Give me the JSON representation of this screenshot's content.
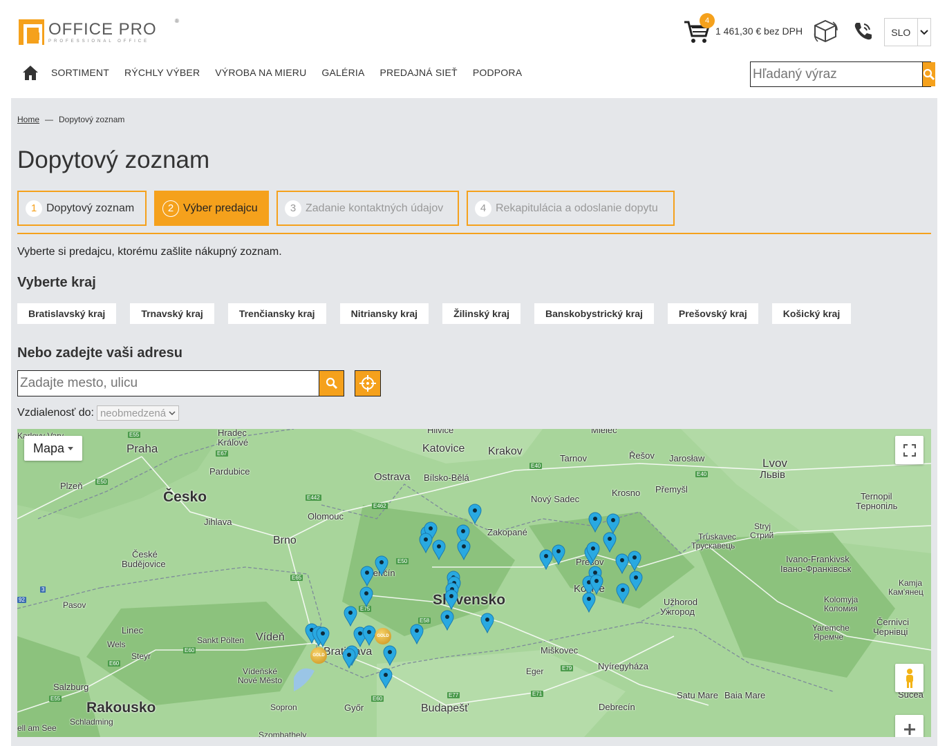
{
  "brand": {
    "name": "OFFICE PRO",
    "tagline": "PROFESSIONAL OFFICE",
    "reg": "®"
  },
  "cart": {
    "count": "4",
    "total": "1 461,30 € bez DPH"
  },
  "language": {
    "selected": "SLO"
  },
  "nav": {
    "items": [
      "SORTIMENT",
      "RÝCHLY VÝBER",
      "VÝROBA NA MIERU",
      "GALÉRIA",
      "PREDAJNÁ SIEŤ",
      "PODPORA"
    ]
  },
  "search": {
    "placeholder": "Hľadaný výraz"
  },
  "breadcrumb": {
    "home": "Home",
    "sep": "—",
    "current": "Dopytový zoznam"
  },
  "page": {
    "title": "Dopytový zoznam",
    "intro": "Vyberte si predajcu, ktorému zašlite nákupný zoznam."
  },
  "steps": [
    {
      "num": "1",
      "label": "Dopytový zoznam"
    },
    {
      "num": "2",
      "label": "Výber predajcu"
    },
    {
      "num": "3",
      "label": "Zadanie kontaktných údajov"
    },
    {
      "num": "4",
      "label": "Rekapitulácia a odoslanie dopytu"
    }
  ],
  "regions": {
    "heading": "Vyberte kraj",
    "items": [
      "Bratislavský kraj",
      "Trnavský kraj",
      "Trenčiansky kraj",
      "Nitriansky kraj",
      "Žilinský kraj",
      "Banskobystrický kraj",
      "Prešovský kraj",
      "Košický kraj"
    ]
  },
  "address": {
    "heading": "Nebo zadejte vaši adresu",
    "placeholder": "Zadajte mesto, ulicu",
    "distance_label": "Vzdialenosť do:",
    "distance_value": "neobmedzená"
  },
  "map": {
    "type_label": "Mapa",
    "places": {
      "karlovy": "Karlovy Vary",
      "hradec": "Hradec",
      "kralove": "Králové",
      "praha": "Praha",
      "pardubice": "Pardubice",
      "plzen": "Plzeň",
      "cesko": "Česko",
      "jihlava": "Jihlava",
      "olomouc": "Olomouc",
      "ostrava": "Ostrava",
      "bielsko": "Bílsko-Bělá",
      "katovice": "Katovice",
      "krakov": "Krakov",
      "tarnov": "Tarnov",
      "resov": "Řešov",
      "jaroslaw": "Jarosław",
      "lvov": "Lvov",
      "lvov2": "Львів",
      "mielec": "Mielec",
      "hlivice": "Hlivice",
      "novysadec": "Nový Sadec",
      "krosno": "Krosno",
      "przemysl": "Přemyšl",
      "zakopane": "Zakopané",
      "brno": "Brno",
      "ceske": "České",
      "budejovice": "Budějovice",
      "trencin": "Trenčín",
      "slovensko": "Slovensko",
      "presov": "Prešov",
      "kosice": "Košice",
      "truskavec": "Truskavec",
      "truskavec2": "Трускавець",
      "stryj": "Stryj",
      "stryj2": "Стрий",
      "ternopil": "Ternopil",
      "ternopil2": "Тернопіль",
      "ivano": "Ivano-Frankivsk",
      "ivano2": "Івано-Франківськ",
      "kamja": "Kamja",
      "kamja2": "Кам'янец",
      "uzhorod": "Užhorod",
      "uzhorod2": "Ужгород",
      "kolomyja": "Kolomyja",
      "kolomyja2": "Коломия",
      "yaremche": "Yaremche",
      "yaremche2": "Яремче",
      "cernivci": "Černivci",
      "cernivci2": "Чернівці",
      "pasov": "Pasov",
      "linec": "Linec",
      "wels": "Wels",
      "steyr": "Steyr",
      "sanktpolten": "Sankt Pölten",
      "viden": "Vídeň",
      "bratislava": "Bratislava",
      "videnske": "Vídeňské",
      "novemesto": "Nové Město",
      "salzburg": "Salzburg",
      "rakousko": "Rakousko",
      "schladming": "Schladming",
      "sopron": "Sopron",
      "gyor": "Győr",
      "budapest": "Budapešť",
      "miskovec": "Miškovec",
      "eger": "Eger",
      "nyiregyhaza": "Nyíregyháza",
      "debrecin": "Debrecín",
      "satumare": "Satu Mare",
      "baiamare": "Baia Mare",
      "suceava": "Sucea",
      "zellamsee": "ell am See",
      "szombathely": "Szombathely"
    },
    "roads": [
      "E55",
      "E67",
      "E50",
      "E442",
      "E462",
      "E40",
      "E40",
      "E65",
      "E50",
      "E75",
      "E58",
      "E60",
      "E60",
      "E79",
      "E77",
      "E71",
      "E55",
      "E60",
      "3",
      "92"
    ],
    "gold_label": "GOLD"
  },
  "colors": {
    "accent": "#f5a11c",
    "map_land": "#a8d59b",
    "pin": "#29a9e1"
  }
}
